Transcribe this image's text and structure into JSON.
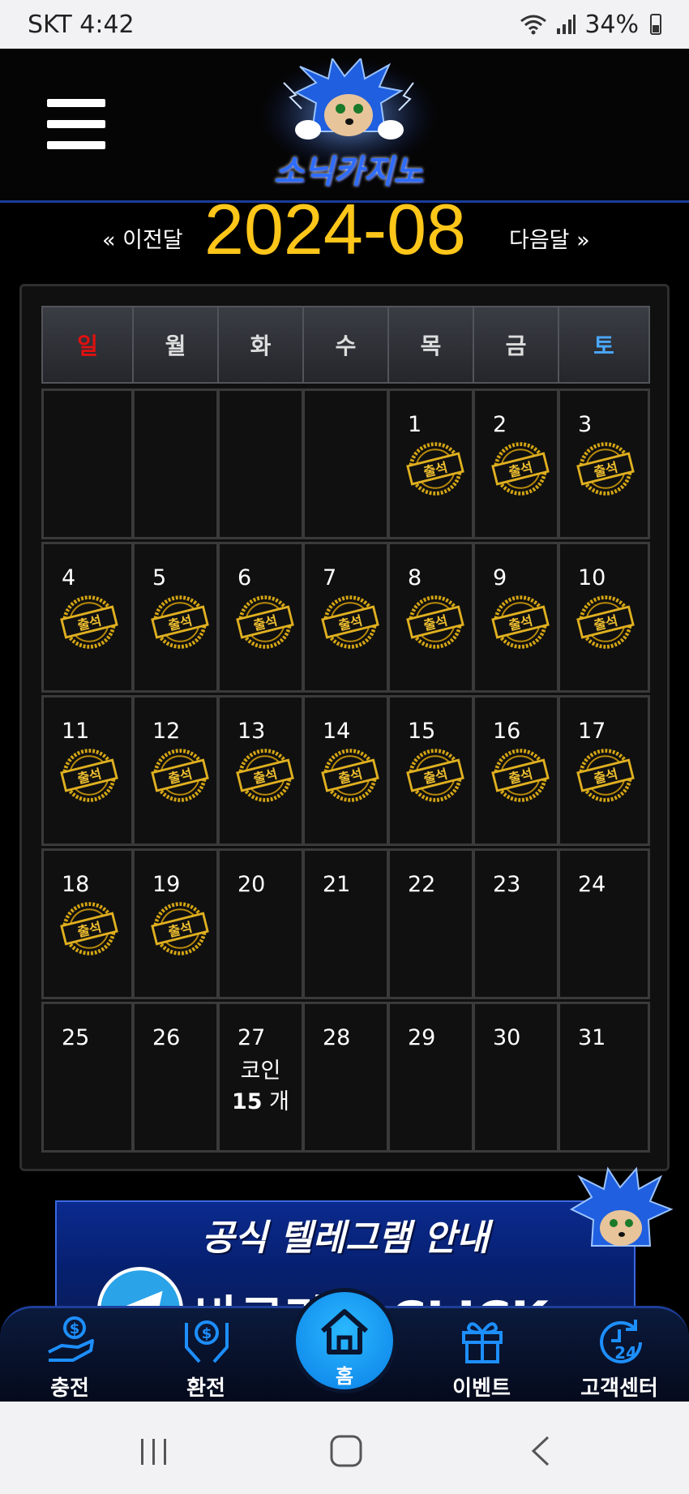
{
  "status_bar": {
    "carrier_time": "SKT 4:42",
    "battery": "34%",
    "icons": [
      "wifi-icon",
      "signal-icon",
      "battery-icon"
    ]
  },
  "header": {
    "logo_text": "소닉카지노",
    "menu_icon": "hamburger-menu-icon"
  },
  "month_nav": {
    "prev_label": "« 이전달",
    "title": "2024-08",
    "next_label": "다음달 »"
  },
  "calendar": {
    "weekdays": [
      "일",
      "월",
      "화",
      "수",
      "목",
      "금",
      "토"
    ],
    "stamp_label": "출석",
    "weeks": [
      [
        {
          "day": ""
        },
        {
          "day": ""
        },
        {
          "day": ""
        },
        {
          "day": ""
        },
        {
          "day": "1",
          "attended": true
        },
        {
          "day": "2",
          "attended": true
        },
        {
          "day": "3",
          "attended": true
        }
      ],
      [
        {
          "day": "4",
          "attended": true
        },
        {
          "day": "5",
          "attended": true
        },
        {
          "day": "6",
          "attended": true
        },
        {
          "day": "7",
          "attended": true
        },
        {
          "day": "8",
          "attended": true
        },
        {
          "day": "9",
          "attended": true
        },
        {
          "day": "10",
          "attended": true
        }
      ],
      [
        {
          "day": "11",
          "attended": true
        },
        {
          "day": "12",
          "attended": true
        },
        {
          "day": "13",
          "attended": true
        },
        {
          "day": "14",
          "attended": true
        },
        {
          "day": "15",
          "attended": true
        },
        {
          "day": "16",
          "attended": true
        },
        {
          "day": "17",
          "attended": true
        }
      ],
      [
        {
          "day": "18",
          "attended": true
        },
        {
          "day": "19",
          "attended": true
        },
        {
          "day": "20"
        },
        {
          "day": "21"
        },
        {
          "day": "22"
        },
        {
          "day": "23"
        },
        {
          "day": "24"
        }
      ],
      [
        {
          "day": "25"
        },
        {
          "day": "26"
        },
        {
          "day": "27",
          "coin_label": "코인",
          "coin_count": "15",
          "coin_unit": "개"
        },
        {
          "day": "28"
        },
        {
          "day": "29"
        },
        {
          "day": "30"
        },
        {
          "day": "31"
        }
      ]
    ]
  },
  "banner": {
    "title": "공식 텔레그램 안내",
    "cta": "바로가기 CLICK",
    "icon": "telegram-icon"
  },
  "bottom_nav": {
    "items": [
      {
        "label": "충전",
        "icon": "deposit-icon"
      },
      {
        "label": "환전",
        "icon": "exchange-icon"
      },
      {
        "label": "홈",
        "icon": "home-icon"
      },
      {
        "label": "이벤트",
        "icon": "gift-icon"
      },
      {
        "label": "고객센터",
        "icon": "support-24-icon"
      }
    ]
  },
  "colors": {
    "accent_gold": "#ffc61a",
    "sunday": "#e01010",
    "saturday": "#4aa8ff",
    "nav_blue": "#1d8fff"
  }
}
